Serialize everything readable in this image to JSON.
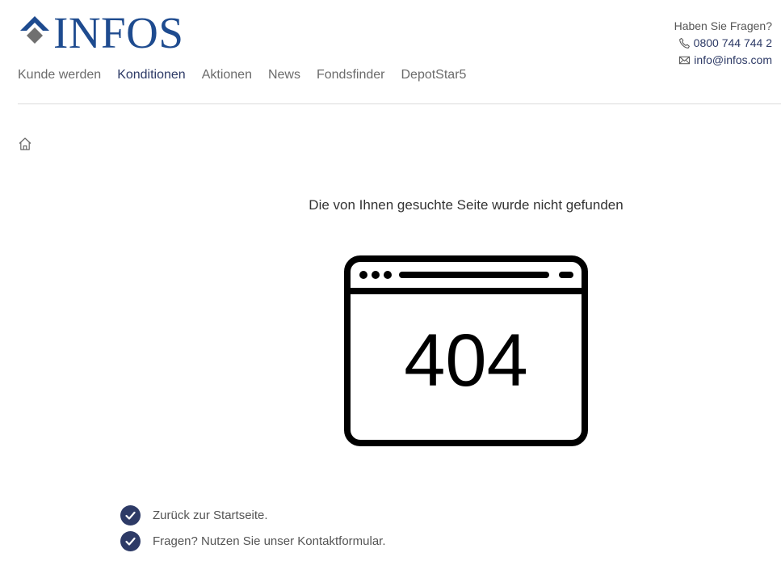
{
  "brand": {
    "name": "INFOS",
    "color": "#1e4b8f"
  },
  "nav": {
    "items": [
      {
        "label": "Kunde werden"
      },
      {
        "label": "Konditionen"
      },
      {
        "label": "Aktionen"
      },
      {
        "label": "News"
      },
      {
        "label": "Fondsfinder"
      },
      {
        "label": "DepotStar5"
      }
    ]
  },
  "contact": {
    "question": "Haben Sie Fragen?",
    "phone": "0800 744 744 2",
    "email": "info@infos.com"
  },
  "breadcrumb": {
    "icon": "home-icon"
  },
  "error": {
    "title": "Die von Ihnen gesuchte Seite wurde nicht gefunden",
    "code": "404"
  },
  "links": {
    "home_prefix": "Zurück zur ",
    "home_link": "Startseite.",
    "contact_prefix": "Fragen? Nutzen Sie unser ",
    "contact_link": "Kontaktformular."
  },
  "colors": {
    "accent": "#2d3a66",
    "divider": "#dcdcdc"
  }
}
